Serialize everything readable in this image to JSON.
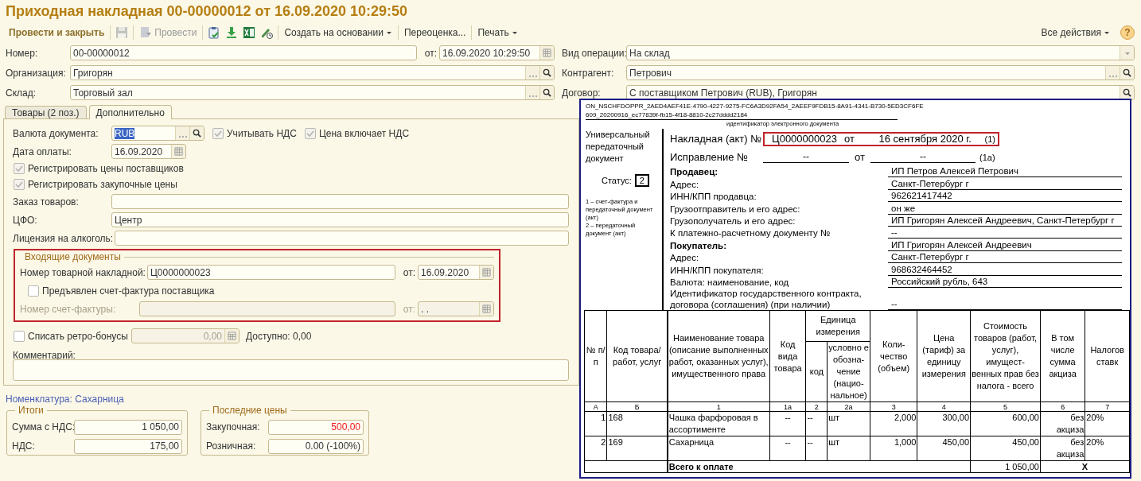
{
  "window": {
    "title": "Приходная накладная 00-00000012 от 16.09.2020 10:29:50"
  },
  "toolbar": {
    "post_close": "Провести и закрыть",
    "save": {
      "disabled": true
    },
    "post": {
      "label": "Провести",
      "disabled": true
    },
    "menus": [
      {
        "label": "Создать на основании",
        "dropdown": true
      },
      {
        "label": "Переоценка...",
        "dropdown": false
      },
      {
        "label": "Печать",
        "dropdown": true
      }
    ],
    "all_actions": {
      "label": "Все действия",
      "dropdown": true
    },
    "help": "?"
  },
  "header": {
    "number": {
      "label": "Номер:",
      "value": "00-00000012"
    },
    "date": {
      "label": "от:",
      "value": "16.09.2020 10:29:50"
    },
    "organization": {
      "label": "Организация:",
      "value": "Григорян"
    },
    "warehouse": {
      "label": "Склад:",
      "value": "Торговый зал"
    },
    "operation": {
      "label": "Вид операции:",
      "value": "На склад"
    },
    "counterparty": {
      "label": "Контрагент:",
      "value": "Петрович"
    },
    "contract": {
      "label": "Договор:",
      "value": "С поставщиком Петрович (RUB), Григорян"
    }
  },
  "tabs": [
    {
      "label": "Товары (2 поз.)",
      "selected": false
    },
    {
      "label": "Дополнительно",
      "selected": true
    }
  ],
  "extra": {
    "currency": {
      "label": "Валюта документа:",
      "value": "RUB",
      "value_selected": true
    },
    "vat_flags": [
      {
        "label": "Учитывать НДС",
        "checked": true,
        "disabled": true
      },
      {
        "label": "Цена включает НДС",
        "checked": true,
        "disabled": true
      }
    ],
    "payment_date": {
      "label": "Дата оплаты:",
      "value": "16.09.2020"
    },
    "register_flags": [
      {
        "label": "Регистрировать цены поставщиков",
        "checked": true,
        "disabled": true
      },
      {
        "label": "Регистрировать закупочные цены",
        "checked": true,
        "disabled": true
      }
    ],
    "plain_fields": [
      {
        "label": "Заказ товаров:"
      },
      {
        "label": "ЦФО:",
        "value": "Центр"
      },
      {
        "label": "Лицензия на алкоголь:"
      }
    ],
    "incoming": {
      "title": "Входящие документы",
      "waybill": {
        "label": "Номер товарной накладной:",
        "value": "Ц0000000023",
        "date_label": "от:",
        "date": "16.09.2020",
        "disabled": false
      },
      "invoice_flag": {
        "label": "Предъявлен счет-фактура поставщика",
        "checked": false,
        "disabled": false
      },
      "invoice": {
        "label": "Номер счет-фактуры:",
        "date_label": "от:",
        "date": ". .",
        "disabled": true
      }
    },
    "retro": {
      "label": "Списать ретро-бонусы",
      "checked": false,
      "value": "0,00",
      "available": "Доступно: 0,00"
    },
    "comment": {
      "label": "Комментарий:"
    }
  },
  "nomenclature_link": "Номенклатура: Сахарница",
  "totals": {
    "title": "Итоги",
    "rows": [
      {
        "label": "Сумма с НДС:",
        "value": "1 050,00",
        "alert": false
      },
      {
        "label": "НДС:",
        "value": "175,00",
        "alert": false
      }
    ]
  },
  "last_prices": {
    "title": "Последние цены",
    "rows": [
      {
        "label": "Закупочная:",
        "value": "500,00",
        "alert": true
      },
      {
        "label": "Розничная:",
        "value": "0.00 (-100%)",
        "alert": false
      }
    ]
  },
  "document": {
    "id_lines": [
      "ON_NSCHFDOPPR_2AED4AEF41E-4790-4227-9275-FC6A3D92FA54_2AEEF9FDB15-8A91-4341-B730-5ED3CF6FE",
      "609_20200916_ec77839f-fb15-4f18-8810-2c27dddd2184"
    ],
    "id_caption": "идентификатор электронного документа",
    "doc_type": "Универсальный передаточный документ",
    "status_label": "Статус:",
    "status": "2",
    "status_notes": [
      "1 – счет-фактура и передаточный документ (акт)",
      "2 – передаточный документ (акт)"
    ],
    "invoice": {
      "label": "Накладная (акт) №",
      "number": "Ц0000000023",
      "from": "от",
      "date": "16 сентября 2020 г.",
      "mark": "(1)"
    },
    "correction": {
      "label": "Исправление №",
      "number": "--",
      "from": "от",
      "date": "--",
      "mark": "(1а)"
    },
    "parties": [
      {
        "label": "Продавец:",
        "value": "ИП Петров Алексей Петрович",
        "bold": true
      },
      {
        "label": "Адрес:",
        "value": "Санкт-Петербург г",
        "bold": false
      },
      {
        "label": "ИНН/КПП продавца:",
        "value": "962621417442",
        "bold": false
      },
      {
        "label": "Грузоотправитель и его адрес:",
        "value": "он же",
        "bold": false
      },
      {
        "label": "Грузополучатель и его адрес:",
        "value": "ИП Григорян Алексей Андреевич, Санкт-Петербург г",
        "bold": false
      },
      {
        "label": "К платежно-расчетному документу №",
        "value": "--",
        "bold": false
      },
      {
        "label": "Покупатель:",
        "value": "ИП Григорян Алексей Андреевич",
        "bold": true
      },
      {
        "label": "Адрес:",
        "value": "Санкт-Петербург г",
        "bold": false
      },
      {
        "label": "ИНН/КПП покупателя:",
        "value": "968632464452",
        "bold": false
      },
      {
        "label": "Валюта: наименование, код",
        "value": "Российский рубль, 643",
        "bold": false
      },
      {
        "label": "Идентификатор государственного контракта, договора (соглашения) (при наличии)",
        "value": "--",
        "bold": false
      }
    ],
    "columns": [
      {
        "label": "№ п/п"
      },
      {
        "label": "Код товара/ работ, услуг"
      },
      {
        "label": "Наименование товара (описание выполненных работ, оказанных услуг), имущественного права"
      },
      {
        "label": "Код вида товара"
      },
      {
        "label": "Единица измерения",
        "colspan": 2,
        "children": [
          {
            "label": "код"
          },
          {
            "label": "условно е обозна- чение (нацио- нальное)"
          }
        ]
      },
      {
        "label": "Коли- чество (объем)"
      },
      {
        "label": "Цена (тариф) за единицу измерения"
      },
      {
        "label": "Стоимость товаров (работ, услуг), имущест- венных прав без налога - всего"
      },
      {
        "label": "В том числе сумма акциза"
      },
      {
        "label": "Налогов ставк"
      }
    ],
    "column_numbers": [
      "А",
      "Б",
      "1",
      "1а",
      "2",
      "2а",
      "3",
      "4",
      "5",
      "6",
      "7"
    ],
    "rows": [
      [
        "1",
        "168",
        "Чашка фарфоровая в ассортименте",
        "--",
        "--",
        "шт",
        "2,000",
        "300,00",
        "600,00",
        "без акциза",
        "20%"
      ],
      [
        "2",
        "169",
        "Сахарница",
        "--",
        "--",
        "шт",
        "1,000",
        "450,00",
        "450,00",
        "без акциза",
        "20%"
      ]
    ],
    "total": {
      "label": "Всего к оплате",
      "amount": "1 050,00",
      "excise": "X"
    }
  }
}
